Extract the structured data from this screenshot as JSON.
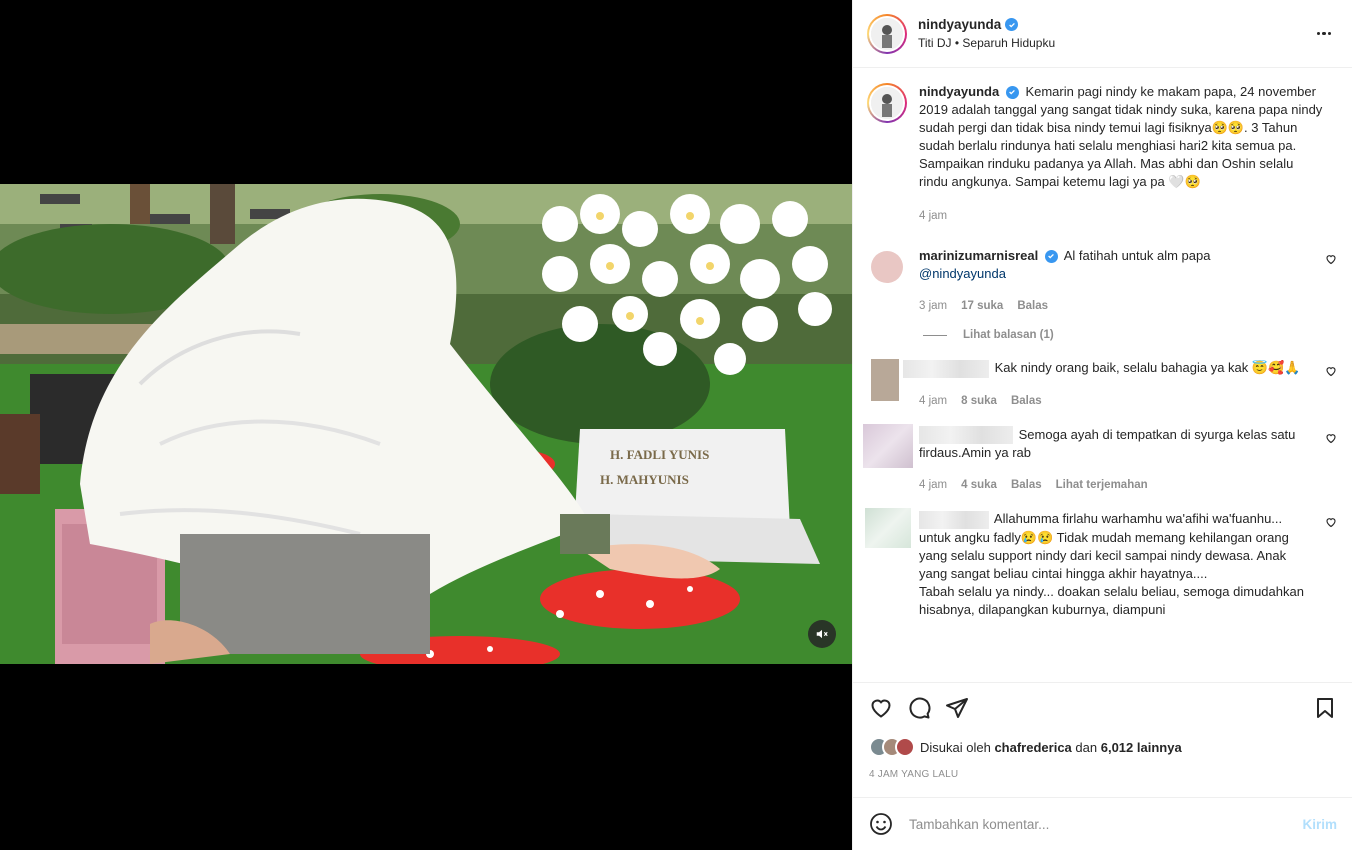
{
  "header": {
    "username": "nindyayunda",
    "subtitle": "Titi DJ • Separuh Hidupku"
  },
  "caption": {
    "username": "nindyayunda",
    "text": "Kemarin pagi nindy ke makam papa, 24 november 2019 adalah tanggal yang sangat tidak nindy suka, karena papa nindy sudah pergi dan tidak bisa nindy temui lagi fisiknya🥺🥺. 3 Tahun sudah berlalu rindunya hati selalu menghiasi hari2 kita semua pa. Sampaikan rinduku padanya ya Allah. Mas abhi dan Oshin selalu rindu angkunya. Sampai ketemu lagi ya pa 🤍🥺",
    "time": "4 jam"
  },
  "comments": [
    {
      "username": "marinizumarnisreal",
      "text": "Al fatihah untuk alm papa",
      "mention": "@nindyayunda",
      "time": "3 jam",
      "likes": "17 suka",
      "reply": "Balas",
      "view_replies": "Lihat balasan (1)"
    },
    {
      "text": "Kak nindy orang baik, selalu bahagia ya kak 😇🥰🙏",
      "time": "4 jam",
      "likes": "8 suka",
      "reply": "Balas"
    },
    {
      "text": "Semoga ayah di tempatkan di syurga kelas satu firdaus.Amin ya rab",
      "time": "4 jam",
      "likes": "4 suka",
      "reply": "Balas",
      "translate": "Lihat terjemahan"
    },
    {
      "text": "Allahumma firlahu warhamhu wa'afihi wa'fuanhu... untuk angku fadly😢😢 Tidak mudah memang kehilangan orang yang selalu support nindy dari kecil sampai nindy dewasa. Anak yang sangat beliau cintai hingga akhir hayatnya....",
      "text2": "Tabah selalu ya nindy... doakan selalu beliau, semoga dimudahkan hisabnya, dilapangkan kuburnya, diampuni"
    }
  ],
  "likes": {
    "prefix": "Disukai oleh",
    "user": "chafrederica",
    "and": "dan",
    "others": "6,012 lainnya"
  },
  "time_ago": "4 JAM YANG LALU",
  "add_comment": {
    "placeholder": "Tambahkan komentar...",
    "send": "Kirim"
  },
  "icons": [
    "verified-icon",
    "more-icon",
    "heart-icon",
    "comment-icon",
    "share-icon",
    "bookmark-icon",
    "emoji-icon",
    "mute-icon"
  ]
}
